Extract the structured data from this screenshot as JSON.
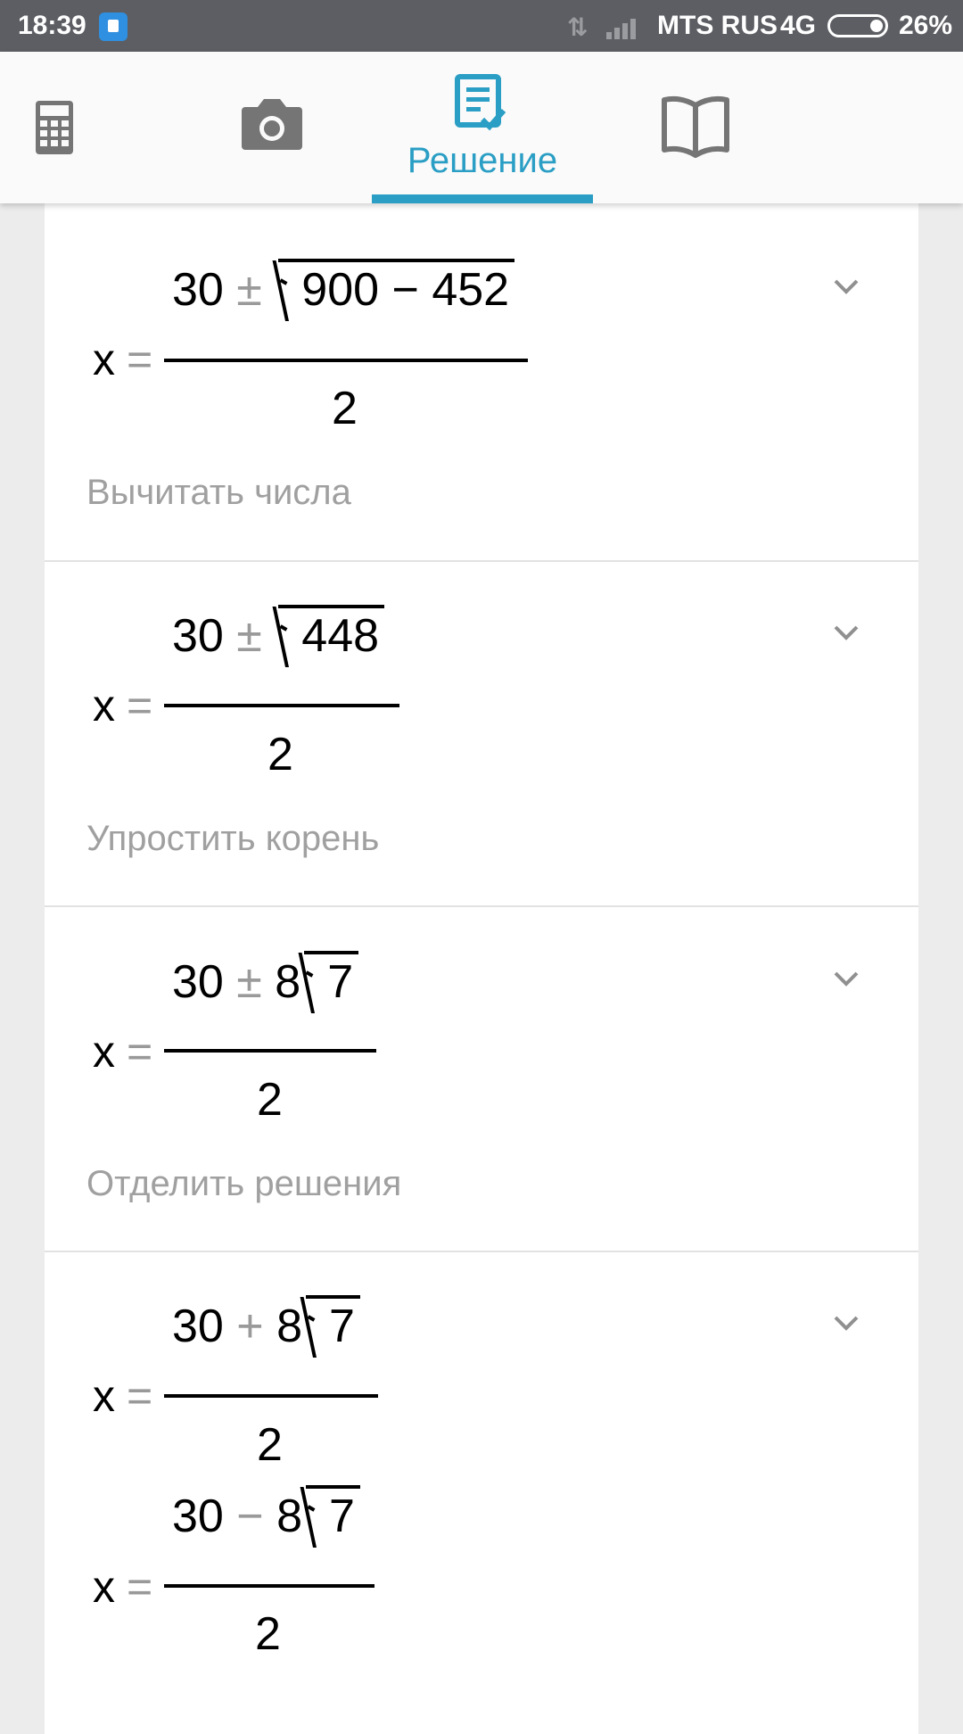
{
  "status_bar": {
    "time": "18:39",
    "carrier": "MTS RUS",
    "network": "4G",
    "battery": "26%",
    "battery_level": 0.26
  },
  "tabs": [
    {
      "icon": "calculator-icon"
    },
    {
      "icon": "camera-icon"
    },
    {
      "icon": "solution-icon",
      "label": "Решение",
      "active": true
    },
    {
      "icon": "book-icon"
    }
  ],
  "accent_color": "#2a9ec4",
  "steps": [
    {
      "var": "x",
      "equals": "=",
      "numerator_left": "30",
      "op": "±",
      "radicand": "900 − 452",
      "denominator": "2",
      "hint": "Вычитать числа"
    },
    {
      "var": "x",
      "equals": "=",
      "numerator_left": "30",
      "op": "±",
      "radicand": "448",
      "denominator": "2",
      "hint": "Упростить корень"
    },
    {
      "var": "x",
      "equals": "=",
      "numerator_left": "30",
      "op": "±",
      "coef": "8",
      "radicand": "7",
      "denominator": "2",
      "hint": "Отделить решения"
    },
    {
      "solutions": [
        {
          "var": "x",
          "equals": "=",
          "numerator_left": "30",
          "op": "+",
          "coef": "8",
          "radicand": "7",
          "denominator": "2"
        },
        {
          "var": "x",
          "equals": "=",
          "numerator_left": "30",
          "op": "−",
          "coef": "8",
          "radicand": "7",
          "denominator": "2"
        }
      ]
    }
  ]
}
